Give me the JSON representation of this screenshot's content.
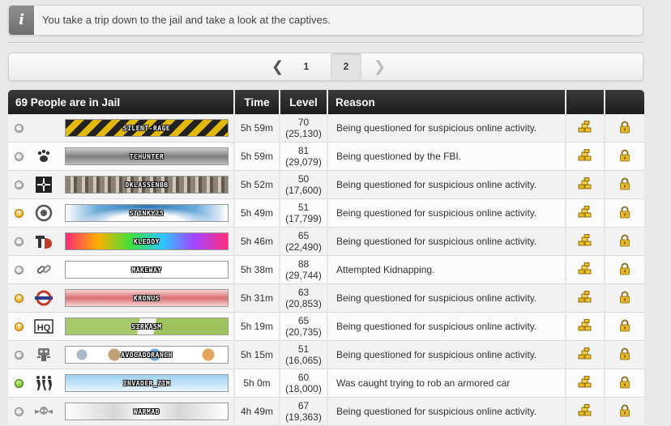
{
  "info": {
    "icon": "info-icon",
    "message": "You take a trip down to the jail and take a look at the captives."
  },
  "pagination": {
    "prev": "❮",
    "pages": [
      "1",
      "2"
    ],
    "current": "2",
    "next": "❯"
  },
  "table": {
    "headers": {
      "title": "69 People are in Jail",
      "time": "Time",
      "level": "Level",
      "reason": "Reason"
    },
    "rows": [
      {
        "status": "idle",
        "faction_icon": "none",
        "name": "Silent-Rage",
        "time": "5h 59m",
        "level": "70",
        "level_sub": "(25,130)",
        "reason": "Being questioned for suspicious online activity."
      },
      {
        "status": "idle",
        "faction_icon": "paw-icon",
        "name": "TCHunter",
        "time": "5h 59m",
        "level": "81",
        "level_sub": "(29,079)",
        "reason": "Being questioned by the FBI."
      },
      {
        "status": "idle",
        "faction_icon": "crosshair-icon",
        "name": "DKlassenBB",
        "time": "5h 52m",
        "level": "50",
        "level_sub": "(17,600)",
        "reason": "Being questioned for suspicious online activity."
      },
      {
        "status": "away",
        "faction_icon": "target-icon",
        "name": "Stinky25",
        "time": "5h 49m",
        "level": "51",
        "level_sub": "(17,799)",
        "reason": "Being questioned for suspicious online activity."
      },
      {
        "status": "idle",
        "faction_icon": "td-logo-icon",
        "name": "kleddy",
        "time": "5h 46m",
        "level": "65",
        "level_sub": "(22,490)",
        "reason": "Being questioned for suspicious online activity."
      },
      {
        "status": "idle",
        "faction_icon": "chain-icon",
        "name": "Makeway",
        "time": "5h 38m",
        "level": "88",
        "level_sub": "(29,744)",
        "reason": "Attempted Kidnapping."
      },
      {
        "status": "away",
        "faction_icon": "underground-icon",
        "name": "Kronus",
        "time": "5h 31m",
        "level": "63",
        "level_sub": "(20,853)",
        "reason": "Being questioned for suspicious online activity."
      },
      {
        "status": "away",
        "faction_icon": "hq-logo-icon",
        "name": "Sirkasm",
        "time": "5h 19m",
        "level": "65",
        "level_sub": "(20,735)",
        "reason": "Being questioned for suspicious online activity."
      },
      {
        "status": "idle",
        "faction_icon": "robot-icon",
        "name": "AvocadoRanch",
        "time": "5h 15m",
        "level": "51",
        "level_sub": "(16,065)",
        "reason": "Being questioned for suspicious online activity."
      },
      {
        "status": "online",
        "faction_icon": "dancers-icon",
        "name": "Invader_Zim",
        "time": "5h 0m",
        "level": "60",
        "level_sub": "(18,000)",
        "reason": "Was caught trying to rob an armored car"
      },
      {
        "status": "idle",
        "faction_icon": "skull-wings-icon",
        "name": "Warmad",
        "time": "4h 49m",
        "level": "67",
        "level_sub": "(19,363)",
        "reason": "Being questioned for suspicious online activity."
      }
    ],
    "bust_icon": "gold-bars-icon",
    "bail_icon": "padlock-icon"
  }
}
